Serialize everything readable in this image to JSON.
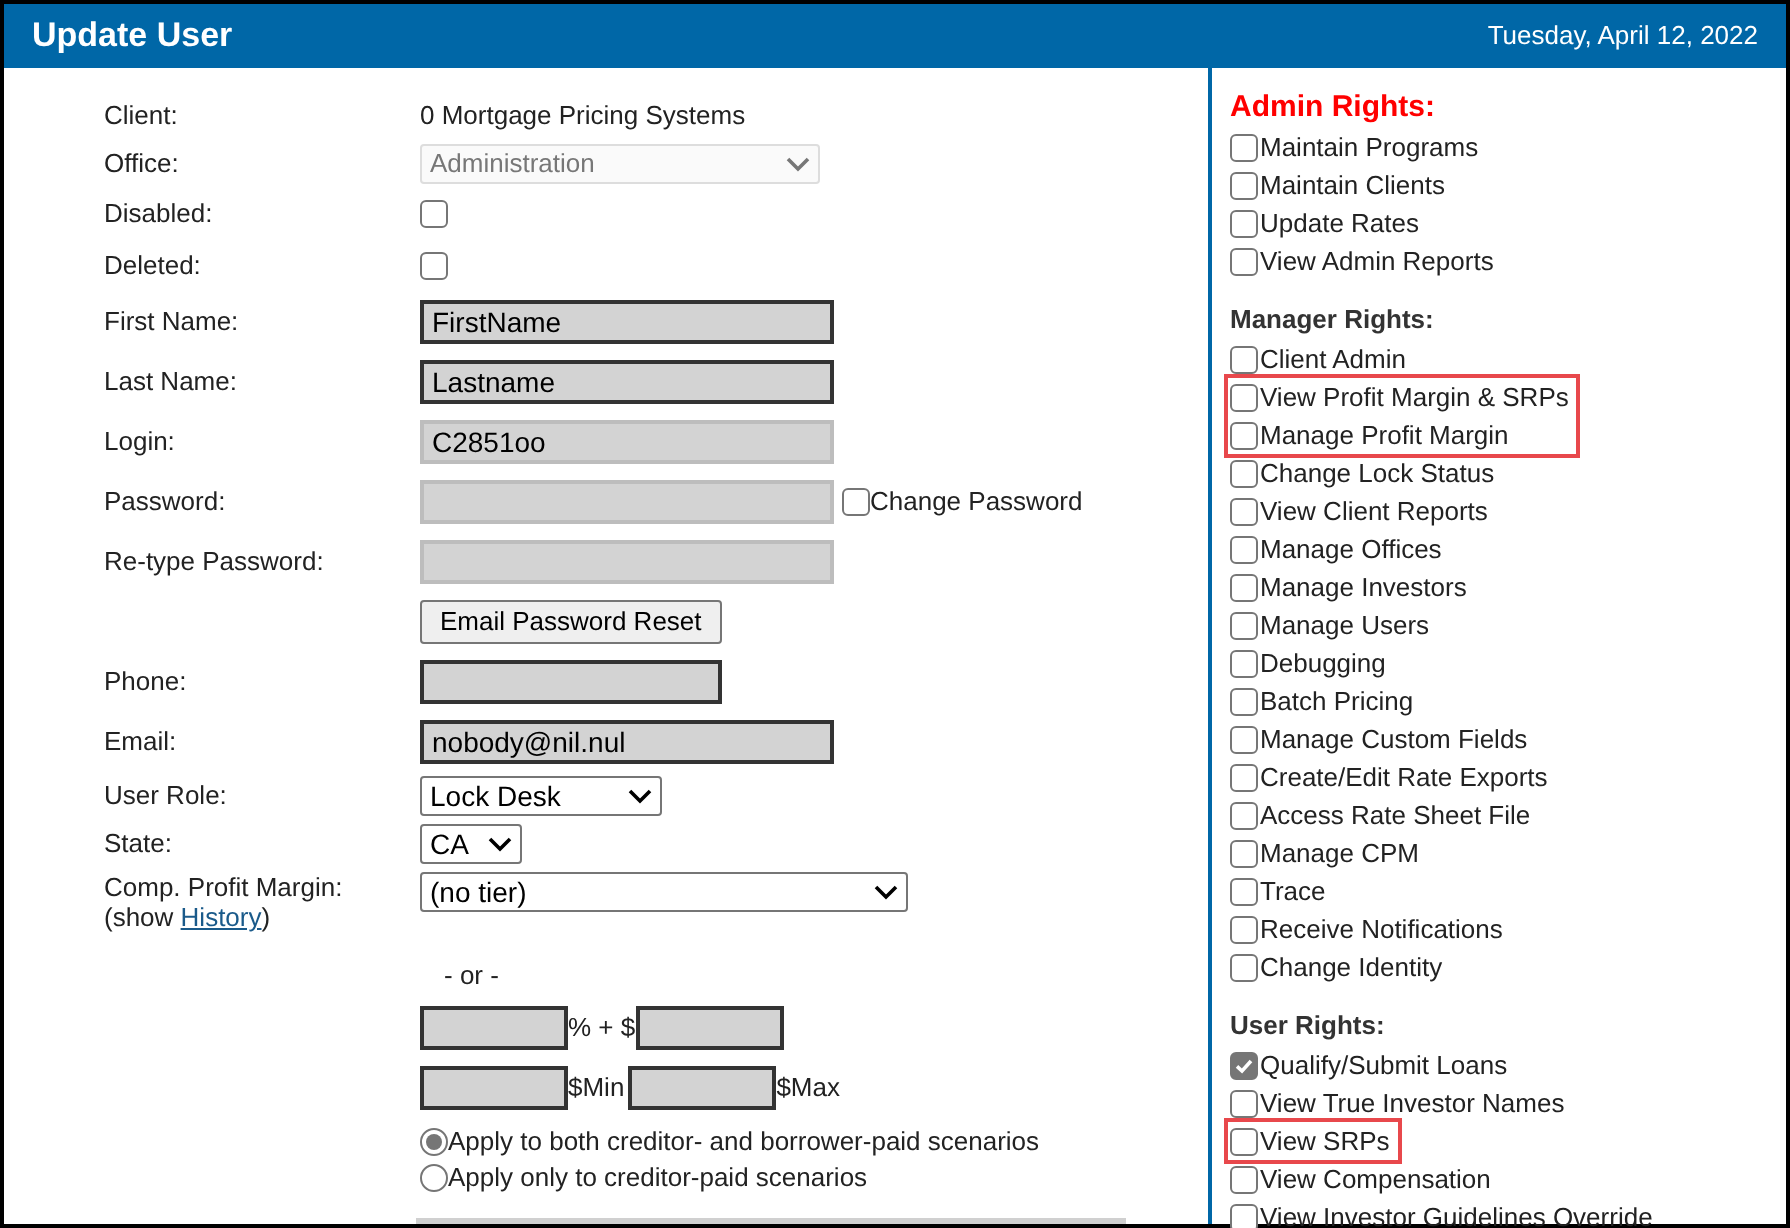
{
  "header": {
    "title": "Update User",
    "date": "Tuesday, April 12, 2022"
  },
  "form": [
    {
      "kind": "text",
      "label": "Client:",
      "value": "0 Mortgage Pricing Systems"
    },
    {
      "kind": "select",
      "label": "Office:",
      "value": "Administration",
      "disabled": true
    },
    {
      "kind": "checkbox",
      "label": "Disabled:",
      "checked": false
    },
    {
      "kind": "checkbox",
      "label": "Deleted:",
      "checked": false
    },
    {
      "kind": "input",
      "label": "First Name:",
      "value": "FirstName",
      "outlined": true
    },
    {
      "kind": "input",
      "label": "Last Name:",
      "value": "Lastname",
      "outlined": true
    },
    {
      "kind": "input",
      "label": "Login:",
      "value": "C2851oo",
      "outlined": false
    },
    {
      "kind": "password",
      "label": "Password:",
      "outlined": false,
      "option": {
        "label": "Change Password",
        "checked": false
      }
    },
    {
      "kind": "input",
      "label": "Re-type Password:",
      "outlined": false
    },
    {
      "kind": "button",
      "label": "Email Password Reset"
    },
    {
      "kind": "input",
      "label": "Phone:",
      "outlined": true
    },
    {
      "kind": "input",
      "label": "Email:",
      "value": "nobody@nil.nul",
      "outlined": true
    },
    {
      "kind": "select",
      "label": "User Role:",
      "value": "Lock Desk",
      "disabled": false
    },
    {
      "kind": "select",
      "label": "State:",
      "value": "CA",
      "disabled": false
    },
    {
      "kind": "margin",
      "label": "Comp. Profit Margin:",
      "note": "(show ",
      "link": "History",
      "note_end": ")",
      "select": "(no tier)",
      "separator": "- or -",
      "percent_unit": "% + $",
      "min_unit": "$Min",
      "max_unit": "$Max",
      "radios": [
        {
          "label": "Apply to both creditor- and borrower-paid scenarios",
          "selected": true
        },
        {
          "label": "Apply only to creditor-paid scenarios",
          "selected": false
        }
      ]
    }
  ],
  "rights": [
    {
      "title": "Admin Rights:",
      "color": "#ff0000",
      "items": [
        {
          "label": "Maintain Programs",
          "checked": false,
          "highlighted": false
        },
        {
          "label": "Maintain Clients",
          "checked": false,
          "highlighted": false
        },
        {
          "label": "Update Rates",
          "checked": false,
          "highlighted": false
        },
        {
          "label": "View Admin Reports",
          "checked": false,
          "highlighted": false
        }
      ]
    },
    {
      "title": "Manager Rights:",
      "color": "#333333",
      "items": [
        {
          "label": "Client Admin",
          "checked": false,
          "highlighted": false
        },
        {
          "label": "View Profit Margin & SRPs",
          "checked": false,
          "highlighted": true
        },
        {
          "label": "Manage Profit Margin",
          "checked": false,
          "highlighted": true
        },
        {
          "label": "Change Lock Status",
          "checked": false,
          "highlighted": false
        },
        {
          "label": "View Client Reports",
          "checked": false,
          "highlighted": false
        },
        {
          "label": "Manage Offices",
          "checked": false,
          "highlighted": false
        },
        {
          "label": "Manage Investors",
          "checked": false,
          "highlighted": false
        },
        {
          "label": "Manage Users",
          "checked": false,
          "highlighted": false
        },
        {
          "label": "Debugging",
          "checked": false,
          "highlighted": false
        },
        {
          "label": "Batch Pricing",
          "checked": false,
          "highlighted": false
        },
        {
          "label": "Manage Custom Fields",
          "checked": false,
          "highlighted": false
        },
        {
          "label": "Create/Edit Rate Exports",
          "checked": false,
          "highlighted": false
        },
        {
          "label": "Access Rate Sheet File",
          "checked": false,
          "highlighted": false
        },
        {
          "label": "Manage CPM",
          "checked": false,
          "highlighted": false
        },
        {
          "label": "Trace",
          "checked": false,
          "highlighted": false
        },
        {
          "label": "Receive Notifications",
          "checked": false,
          "highlighted": false
        },
        {
          "label": "Change Identity",
          "checked": false,
          "highlighted": false
        }
      ]
    },
    {
      "title": "User Rights:",
      "color": "#333333",
      "items": [
        {
          "label": "Qualify/Submit Loans",
          "checked": true,
          "highlighted": false
        },
        {
          "label": "View True Investor Names",
          "checked": false,
          "highlighted": false
        },
        {
          "label": "View SRPs",
          "checked": false,
          "highlighted": true
        },
        {
          "label": "View Compensation",
          "checked": false,
          "highlighted": false
        },
        {
          "label": "View Investor Guidelines Override",
          "checked": false,
          "highlighted": false
        }
      ]
    }
  ]
}
